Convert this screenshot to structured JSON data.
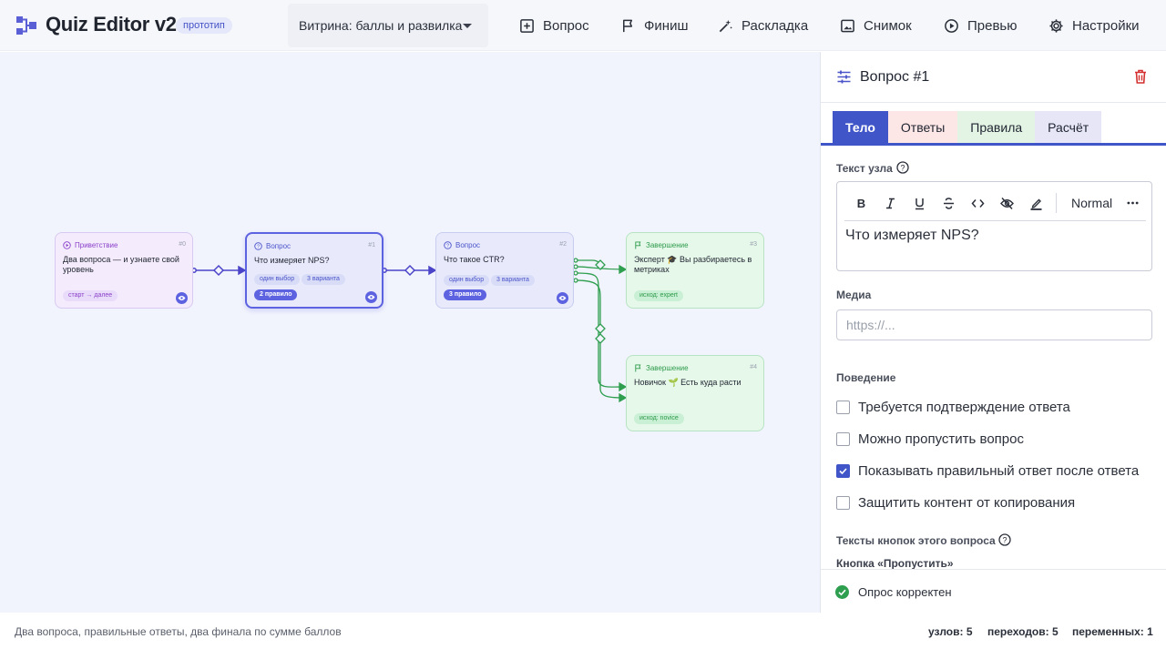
{
  "app": {
    "title": "Quiz Editor v2",
    "badge": "прототип",
    "preset": "Витрина: баллы и развилка"
  },
  "toolbar": [
    {
      "label": "Вопрос",
      "icon": "plus-square-icon"
    },
    {
      "label": "Финиш",
      "icon": "flag-icon"
    },
    {
      "label": "Раскладка",
      "icon": "magic-wand-icon"
    },
    {
      "label": "Снимок",
      "icon": "image-icon"
    },
    {
      "label": "Превью",
      "icon": "play-circle-icon"
    },
    {
      "label": "Настройки",
      "icon": "gear-icon"
    }
  ],
  "nodes": [
    {
      "kind": "Приветствие",
      "index": "#0",
      "title": "Два вопроса — и узнаете свой уровень",
      "chips": [
        "старт → далее"
      ]
    },
    {
      "kind": "Вопрос",
      "index": "#1",
      "title": "Что измеряет NPS?",
      "chips": [
        "один выбор",
        "3 варианта"
      ],
      "rules": "2 правило"
    },
    {
      "kind": "Вопрос",
      "index": "#2",
      "title": "Что такое CTR?",
      "chips": [
        "один выбор",
        "3 варианта"
      ],
      "rules": "3 правило"
    },
    {
      "kind": "Завершение",
      "index": "#3",
      "title": "Эксперт 🎓 Вы разбираетесь в метриках",
      "chips": [
        "исход: expert"
      ]
    },
    {
      "kind": "Завершение",
      "index": "#4",
      "title": "Новичок 🌱 Есть куда расти",
      "chips": [
        "исход: novice"
      ]
    }
  ],
  "panel": {
    "title": "Вопрос #1",
    "tabs": [
      "Тело",
      "Ответы",
      "Правила",
      "Расчёт"
    ],
    "node_text_label": "Текст узла",
    "editor_style": "Normal",
    "node_text": "Что измеряет NPS?",
    "media_label": "Медиа",
    "media_placeholder": "https://...",
    "behavior_label": "Поведение",
    "options": [
      {
        "label": "Требуется подтверждение ответа",
        "checked": false
      },
      {
        "label": "Можно пропустить вопрос",
        "checked": false
      },
      {
        "label": "Показывать правильный ответ после ответа",
        "checked": true
      },
      {
        "label": "Защитить контент от копирования",
        "checked": false
      }
    ],
    "button_texts_label": "Тексты кнопок этого вопроса",
    "skip_button_label": "Кнопка «Пропустить»",
    "validation": "Опрос корректен"
  },
  "footer": {
    "description": "Два вопроса, правильные ответы, два финала по сумме баллов",
    "nodes": "узлов: 5",
    "transitions": "переходов: 5",
    "variables": "переменных: 1"
  },
  "colors": {
    "accent": "#3f55c8",
    "question_edge": "#4b44c9",
    "finish_edge": "#2e9e4f",
    "danger": "#d32f2f"
  }
}
